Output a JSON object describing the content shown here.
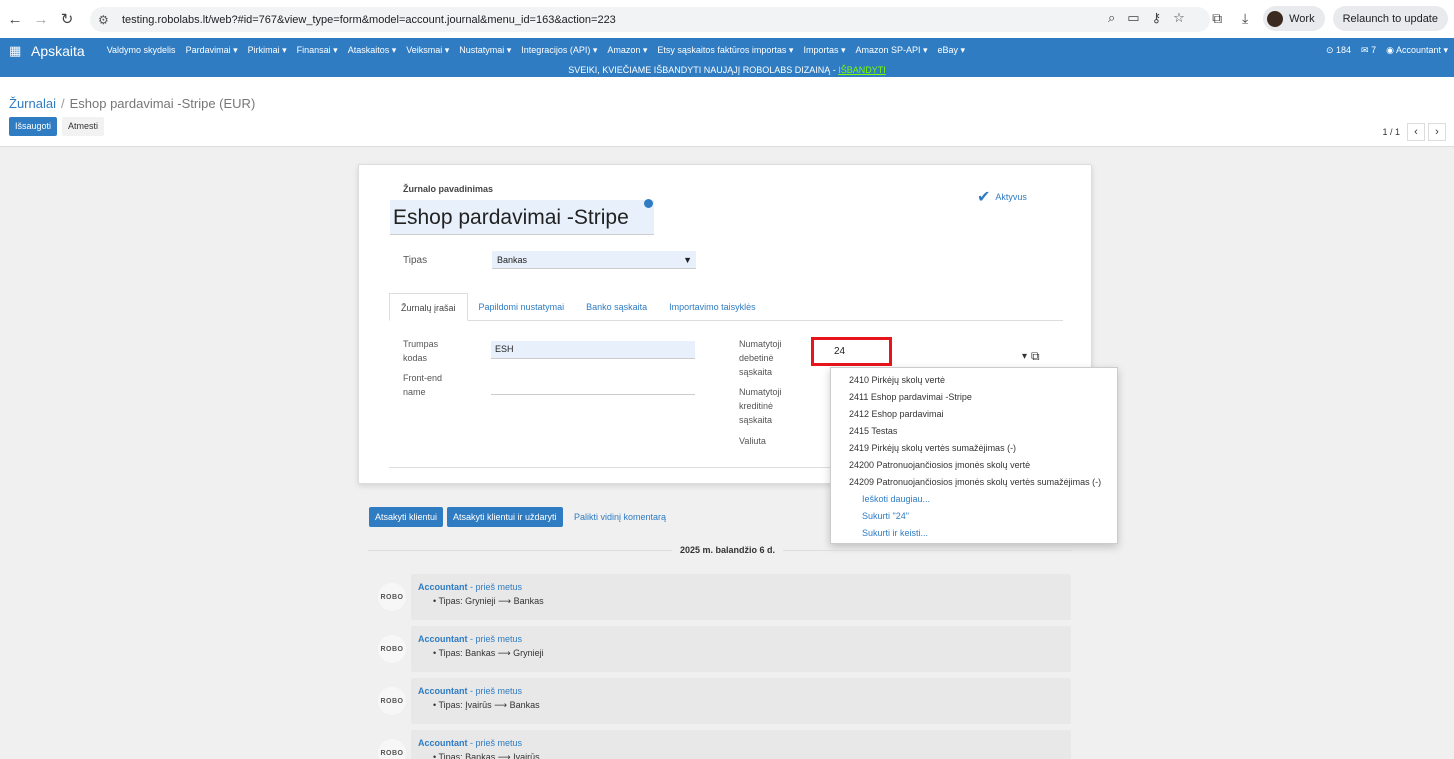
{
  "browser": {
    "url": "testing.robolabs.lt/web?#id=767&view_type=form&model=account.journal&menu_id=163&action=223",
    "profile": "Work",
    "relaunch": "Relaunch to update"
  },
  "appbar": {
    "brand": "Apskaita",
    "menu": [
      "Valdymo skydelis",
      "Pardavimai ▾",
      "Pirkimai ▾",
      "Finansai ▾",
      "Ataskaitos ▾",
      "Veiksmai ▾",
      "Nustatymai ▾",
      "Integracijos (API) ▾",
      "Amazon ▾",
      "Etsy sąskaitos faktūros importas ▾",
      "Importas ▾",
      "Amazon SP-API ▾",
      "eBay ▾"
    ],
    "notifications": "184",
    "messages": "7",
    "user": "Accountant ▾"
  },
  "banner": {
    "text": "SVEIKI, KVIEČIAME IŠBANDYTI NAUJĄJĮ ROBOLABS DIZAINĄ - ",
    "link": "IŠBANDYTI"
  },
  "breadcrumb": {
    "parent": "Žurnalai",
    "current": "Eshop pardavimai -Stripe (EUR)"
  },
  "actions": {
    "save": "Išsaugoti",
    "discard": "Atmesti"
  },
  "pager": "1 / 1",
  "form": {
    "name_label": "Žurnalo pavadinimas",
    "name_value": "Eshop pardavimai -Stripe",
    "active_label": "Aktyvus",
    "type_label": "Tipas",
    "type_value": "Bankas",
    "tabs": [
      "Žurnalų įrašai",
      "Papildomi nustatymai",
      "Banko sąskaita",
      "Importavimo taisyklės"
    ],
    "short_code_label_1": "Trumpas",
    "short_code_label_2": "kodas",
    "short_code_value": "ESH",
    "frontend_label_1": "Front-end",
    "frontend_label_2": "name",
    "debit_label_1": "Numatytoji",
    "debit_label_2": "debetinė",
    "debit_label_3": "sąskaita",
    "debit_value": "24",
    "credit_label_1": "Numatytoji",
    "credit_label_2": "kreditinė",
    "credit_label_3": "sąskaita",
    "currency_label": "Valiuta"
  },
  "dropdown": {
    "items": [
      "2410 Pirkėjų skolų vertė",
      "2411 Eshop pardavimai -Stripe",
      "2412 Eshop pardavimai",
      "2415 Testas",
      "2419 Pirkėjų skolų vertės sumažėjimas (-)",
      "24200 Patronuojančiosios įmonės skolų vertė",
      "24209 Patronuojančiosios įmonės skolų vertės sumažėjimas (-)"
    ],
    "search_more": "Ieškoti daugiau...",
    "create": "Sukurti \"24\"",
    "create_edit": "Sukurti ir keisti..."
  },
  "chatter": {
    "reply": "Atsakyti klientui",
    "reply_close": "Atsakyti klientui ir uždaryti",
    "note": "Palikti vidinį komentarą",
    "date": "2025 m. balandžio 6 d.",
    "avatar_text": "ROBO",
    "messages": [
      {
        "author": "Accountant",
        "when": " - prieš metus",
        "change": "Tipas: Grynieji ⟶ Bankas"
      },
      {
        "author": "Accountant",
        "when": " - prieš metus",
        "change": "Tipas: Bankas ⟶ Grynieji"
      },
      {
        "author": "Accountant",
        "when": " - prieš metus",
        "change": "Tipas: Įvairūs ⟶ Bankas"
      },
      {
        "author": "Accountant",
        "when": " - prieš metus",
        "change": "Tipas: Bankas ⟶ Įvairūs"
      }
    ]
  }
}
